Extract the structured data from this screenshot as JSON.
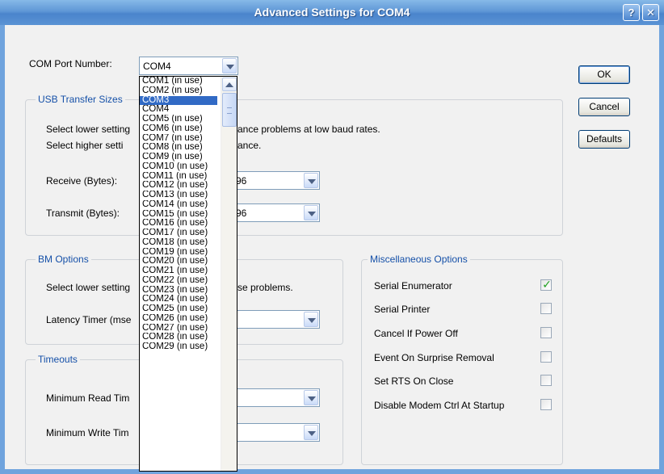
{
  "window": {
    "title": "Advanced Settings for COM4",
    "help_glyph": "?",
    "close_glyph": "✕"
  },
  "com_port": {
    "label": "COM Port Number:",
    "value": "COM4",
    "options": [
      "COM1 (in use)",
      "COM2 (in use)",
      "COM3",
      "COM4",
      "COM5 (in use)",
      "COM6 (in use)",
      "COM7 (in use)",
      "COM8 (in use)",
      "COM9 (in use)",
      "COM10 (in use)",
      "COM11 (in use)",
      "COM12 (in use)",
      "COM13 (in use)",
      "COM14 (in use)",
      "COM15 (in use)",
      "COM16 (in use)",
      "COM17 (in use)",
      "COM18 (in use)",
      "COM19 (in use)",
      "COM20 (in use)",
      "COM21 (in use)",
      "COM22 (in use)",
      "COM23 (in use)",
      "COM24 (in use)",
      "COM25 (in use)",
      "COM26 (in use)",
      "COM27 (in use)",
      "COM28 (in use)",
      "COM29 (in use)"
    ],
    "highlighted": "COM3"
  },
  "usb_transfer": {
    "title": "USB Transfer Sizes",
    "desc1_start": "Select lower setting",
    "desc1_end": "ance problems at low baud rates.",
    "desc2_start": "Select higher setti",
    "desc2_end": "ance.",
    "receive_label": "Receive (Bytes):",
    "receive_value_visible": "96",
    "transmit_label": "Transmit (Bytes):",
    "transmit_value_visible": "96"
  },
  "bm_options": {
    "title": "BM Options",
    "desc_start": "Select lower setting",
    "desc_end": "se problems.",
    "latency_label": "Latency Timer (mse"
  },
  "timeouts": {
    "title": "Timeouts",
    "min_read_label": "Minimum Read Tim",
    "min_write_label": "Minimum Write Tim"
  },
  "misc_options": {
    "title": "Miscellaneous Options",
    "items": [
      {
        "label": "Serial Enumerator",
        "checked": true
      },
      {
        "label": "Serial Printer",
        "checked": false
      },
      {
        "label": "Cancel If Power Off",
        "checked": false
      },
      {
        "label": "Event On Surprise Removal",
        "checked": false
      },
      {
        "label": "Set RTS On Close",
        "checked": false
      },
      {
        "label": "Disable Modem Ctrl At Startup",
        "checked": false
      }
    ],
    "check_glyph": "✓"
  },
  "buttons": {
    "ok": "OK",
    "cancel": "Cancel",
    "defaults": "Defaults"
  }
}
